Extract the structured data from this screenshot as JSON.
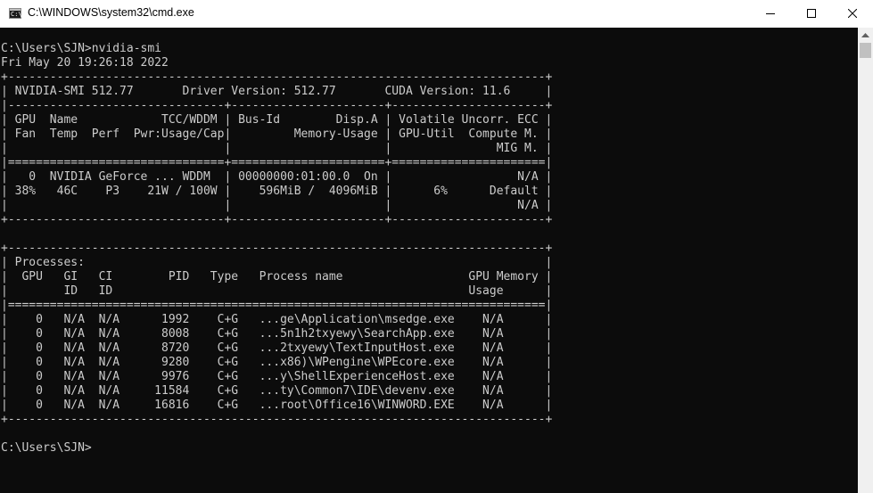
{
  "window": {
    "title": "C:\\WINDOWS\\system32\\cmd.exe",
    "icon_glyph": "C:\\"
  },
  "controls": {
    "minimize_icon": "minimize-icon",
    "maximize_icon": "maximize-icon",
    "close_icon": "close-icon"
  },
  "colors": {
    "terminal_background": "#0c0c0c",
    "terminal_text": "#cccccc",
    "titlebar_background": "#ffffff"
  },
  "console": {
    "lines": [
      "C:\\Users\\SJN>nvidia-smi",
      "Fri May 20 19:26:18 2022",
      "+-----------------------------------------------------------------------------+",
      "| NVIDIA-SMI 512.77       Driver Version: 512.77       CUDA Version: 11.6     |",
      "|-------------------------------+----------------------+----------------------+",
      "| GPU  Name            TCC/WDDM | Bus-Id        Disp.A | Volatile Uncorr. ECC |",
      "| Fan  Temp  Perf  Pwr:Usage/Cap|         Memory-Usage | GPU-Util  Compute M. |",
      "|                               |                      |               MIG M. |",
      "|===============================+======================+======================|",
      "|   0  NVIDIA GeForce ... WDDM  | 00000000:01:00.0  On |                  N/A |",
      "| 38%   46C    P3    21W / 100W |    596MiB /  4096MiB |      6%      Default |",
      "|                               |                      |                  N/A |",
      "+-------------------------------+----------------------+----------------------+",
      "",
      "+-----------------------------------------------------------------------------+",
      "| Processes:                                                                  |",
      "|  GPU   GI   CI        PID   Type   Process name                  GPU Memory |",
      "|        ID   ID                                                   Usage      |",
      "|=============================================================================|",
      "|    0   N/A  N/A      1992    C+G   ...ge\\Application\\msedge.exe    N/A      |",
      "|    0   N/A  N/A      8008    C+G   ...5n1h2txyewy\\SearchApp.exe    N/A      |",
      "|    0   N/A  N/A      8720    C+G   ...2txyewy\\TextInputHost.exe    N/A      |",
      "|    0   N/A  N/A      9280    C+G   ...x86)\\WPengine\\WPEcore.exe    N/A      |",
      "|    0   N/A  N/A      9976    C+G   ...y\\ShellExperienceHost.exe    N/A      |",
      "|    0   N/A  N/A     11584    C+G   ...ty\\Common7\\IDE\\devenv.exe    N/A      |",
      "|    0   N/A  N/A     16816    C+G   ...root\\Office16\\WINWORD.EXE    N/A      |",
      "+-----------------------------------------------------------------------------+",
      "",
      "C:\\Users\\SJN>"
    ]
  }
}
